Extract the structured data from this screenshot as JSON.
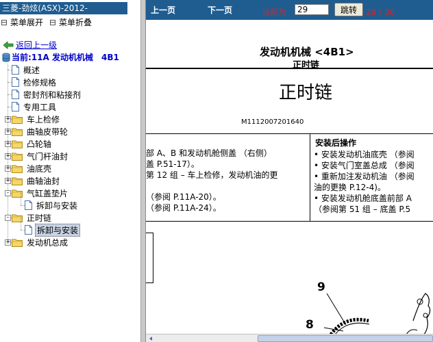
{
  "sidebar": {
    "title": "三菱-劲炫(ASX)-2012-",
    "expand_menu": "菜单展开",
    "collapse_menu": "菜单折叠",
    "back_link": "返回上一级",
    "current_label": "当前:11A 发动机机械　4B1",
    "tree": [
      {
        "type": "doc",
        "label": "概述"
      },
      {
        "type": "doc",
        "label": "检修规格"
      },
      {
        "type": "doc",
        "label": "密封剂和粘接剂"
      },
      {
        "type": "doc",
        "label": "专用工具"
      },
      {
        "type": "folder",
        "label": "车上检修",
        "expander": "+"
      },
      {
        "type": "folder",
        "label": "曲轴皮带轮",
        "expander": "+"
      },
      {
        "type": "folder",
        "label": "凸轮轴",
        "expander": "+"
      },
      {
        "type": "folder",
        "label": "气门杆油封",
        "expander": "+"
      },
      {
        "type": "folder",
        "label": "油底壳",
        "expander": "+"
      },
      {
        "type": "folder",
        "label": "曲轴油封",
        "expander": "+"
      },
      {
        "type": "folder",
        "label": "气缸盖垫片",
        "expander": "-"
      },
      {
        "type": "subdoc",
        "label": "拆卸与安装"
      },
      {
        "type": "folder",
        "label": "正时链",
        "expander": "-"
      },
      {
        "type": "subdoc",
        "label": "拆卸与安装",
        "selected": true
      },
      {
        "type": "folder",
        "label": "发动机总成",
        "expander": "+"
      }
    ]
  },
  "toolbar": {
    "prev_page": "上一页",
    "next_page": "下一页",
    "current_label": "当前为",
    "page_value": "29",
    "go_button": "跳转",
    "page_count": "29 / 36"
  },
  "document": {
    "header_title": "发动机机械 <4B1>",
    "header_subtitle": "正时链",
    "main_title": "正时链",
    "figure_code": "M1112007201640",
    "left_col": [
      "部 A、B 和发动机舱侧盖 （右侧）",
      "盖 P.51-17）。",
      "第 12 组 – 车上检修，发动机油的更",
      "",
      "（参阅 P.11A-20）。",
      "（参阅 P.11A-24）。"
    ],
    "right_heading": "安装后操作",
    "right_col": [
      "•  安装发动机油底壳 （参阅",
      "•  安装气门室盖总成 （参阅",
      "•  重新加注发动机油 （参阅",
      "    油的更换 P.12-4)。",
      "•  安装发动机舱底盖前部 A",
      "    （参阅第 51 组 – 底盖 P.5"
    ],
    "callout_9": "9",
    "callout_8": "8"
  },
  "colors": {
    "title_bar": "#1f5d91",
    "toolbar": "#1f5d91",
    "link": "#0000cc",
    "page_indicator": "#e02020"
  }
}
